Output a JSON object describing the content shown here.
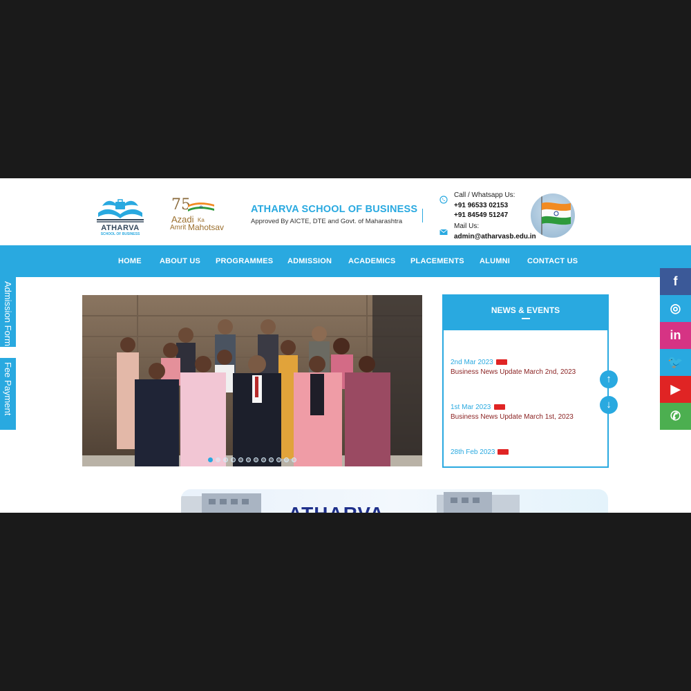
{
  "header": {
    "logo_text": "ATHARVA",
    "logo_sub": "SCHOOL OF BUSINESS",
    "azadi": {
      "num": "75",
      "l1": "Azadi",
      "ka": "Ka",
      "l2": "Amrit",
      "mahotsav": "Mahotsav"
    },
    "title": "ATHARVA SCHOOL OF BUSINESS",
    "subtitle": "Approved By AICTE, DTE and Govt. of Maharashtra",
    "contact": {
      "call_label": "Call / Whatsapp Us:",
      "phone1": "+91 96533 02153",
      "phone2": "+91 84549 51247",
      "mail_label": "Mail Us:",
      "email": "admin@atharvasb.edu.in"
    }
  },
  "nav": [
    "HOME",
    "ABOUT US",
    "PROGRAMMES",
    "ADMISSION",
    "ACADEMICS",
    "PLACEMENTS",
    "ALUMNI",
    "CONTACT US"
  ],
  "side_tabs": {
    "admission": "Admission Form",
    "fee": "Fee Payment"
  },
  "news": {
    "title": "NEWS & EVENTS",
    "items": [
      {
        "date": "2nd Mar 2023",
        "text": "Business News Update March 2nd, 2023"
      },
      {
        "date": "1st Mar 2023",
        "text": "Business News Update March 1st, 2023"
      },
      {
        "date": "28th Feb 2023",
        "text": ""
      }
    ]
  },
  "hero": {
    "slides": 12,
    "active": 1
  },
  "social": [
    {
      "name": "facebook",
      "glyph": "f",
      "color": "#3b5998"
    },
    {
      "name": "instagram",
      "glyph": "◎",
      "color": "#29a9e0"
    },
    {
      "name": "linkedin",
      "glyph": "in",
      "color": "#d63384"
    },
    {
      "name": "twitter",
      "glyph": "🐦",
      "color": "#29a9e0"
    },
    {
      "name": "youtube",
      "glyph": "▶",
      "color": "#e02424"
    },
    {
      "name": "whatsapp",
      "glyph": "✆",
      "color": "#4caf50"
    }
  ],
  "bottom_title": "ATHARVA"
}
